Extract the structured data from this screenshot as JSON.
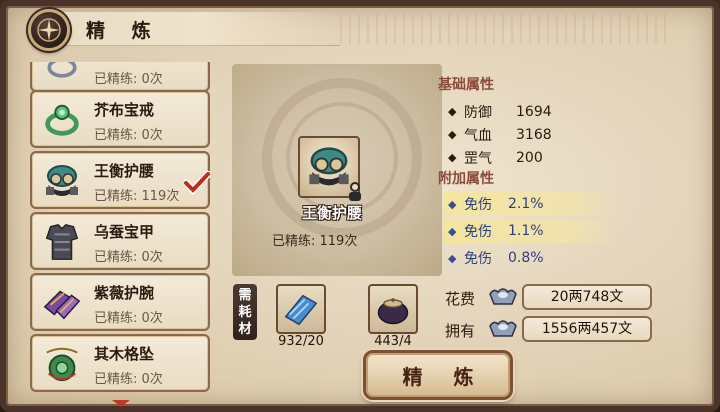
{
  "header": {
    "title": "精 炼"
  },
  "list": {
    "items": [
      {
        "name": "",
        "count": "已精练: 0次",
        "icon": "ring-icon",
        "color": "#7b86a0"
      },
      {
        "name": "芥布宝戒",
        "count": "已精练: 0次",
        "icon": "ring-icon",
        "color": "#3f9a5a"
      },
      {
        "name": "王衡护腰",
        "count": "已精练: 119次",
        "icon": "belt-icon",
        "color": "#3e8a88",
        "selected": true
      },
      {
        "name": "乌蚕宝甲",
        "count": "已精练: 0次",
        "icon": "armor-icon",
        "color": "#5a5a66"
      },
      {
        "name": "紫薇护腕",
        "count": "已精练: 0次",
        "icon": "bracer-icon",
        "color": "#7a4aa0"
      },
      {
        "name": "其木格坠",
        "count": "已精练: 0次",
        "icon": "pendant-icon",
        "color": "#3d8a4a"
      }
    ]
  },
  "equipment": {
    "name": "王衡护腰",
    "count": "已精练: 119次"
  },
  "base_attributes": {
    "title": "基础属性",
    "rows": [
      {
        "label": "防御",
        "value": "1694"
      },
      {
        "label": "气血",
        "value": "3168"
      },
      {
        "label": "罡气",
        "value": "200"
      }
    ]
  },
  "extra_attributes": {
    "title": "附加属性",
    "rows": [
      {
        "label": "免伤",
        "value": "2.1%"
      },
      {
        "label": "免伤",
        "value": "1.1%"
      },
      {
        "label": "免伤",
        "value": "0.8%"
      }
    ]
  },
  "materials": {
    "tag": [
      "需",
      "耗",
      "材"
    ],
    "items": [
      {
        "icon": "blue-cloth-icon",
        "count": "932/20"
      },
      {
        "icon": "clay-pot-icon",
        "count": "443/4"
      }
    ]
  },
  "cost": {
    "label": "花费",
    "value": "20两748文"
  },
  "owned": {
    "label": "拥有",
    "value": "1556两457文"
  },
  "refine_button": {
    "label": "精 炼"
  },
  "colors": {
    "attr_title": "#8b4a3b",
    "extra_text": "#2e3f7d",
    "frame": "#4a342a"
  }
}
